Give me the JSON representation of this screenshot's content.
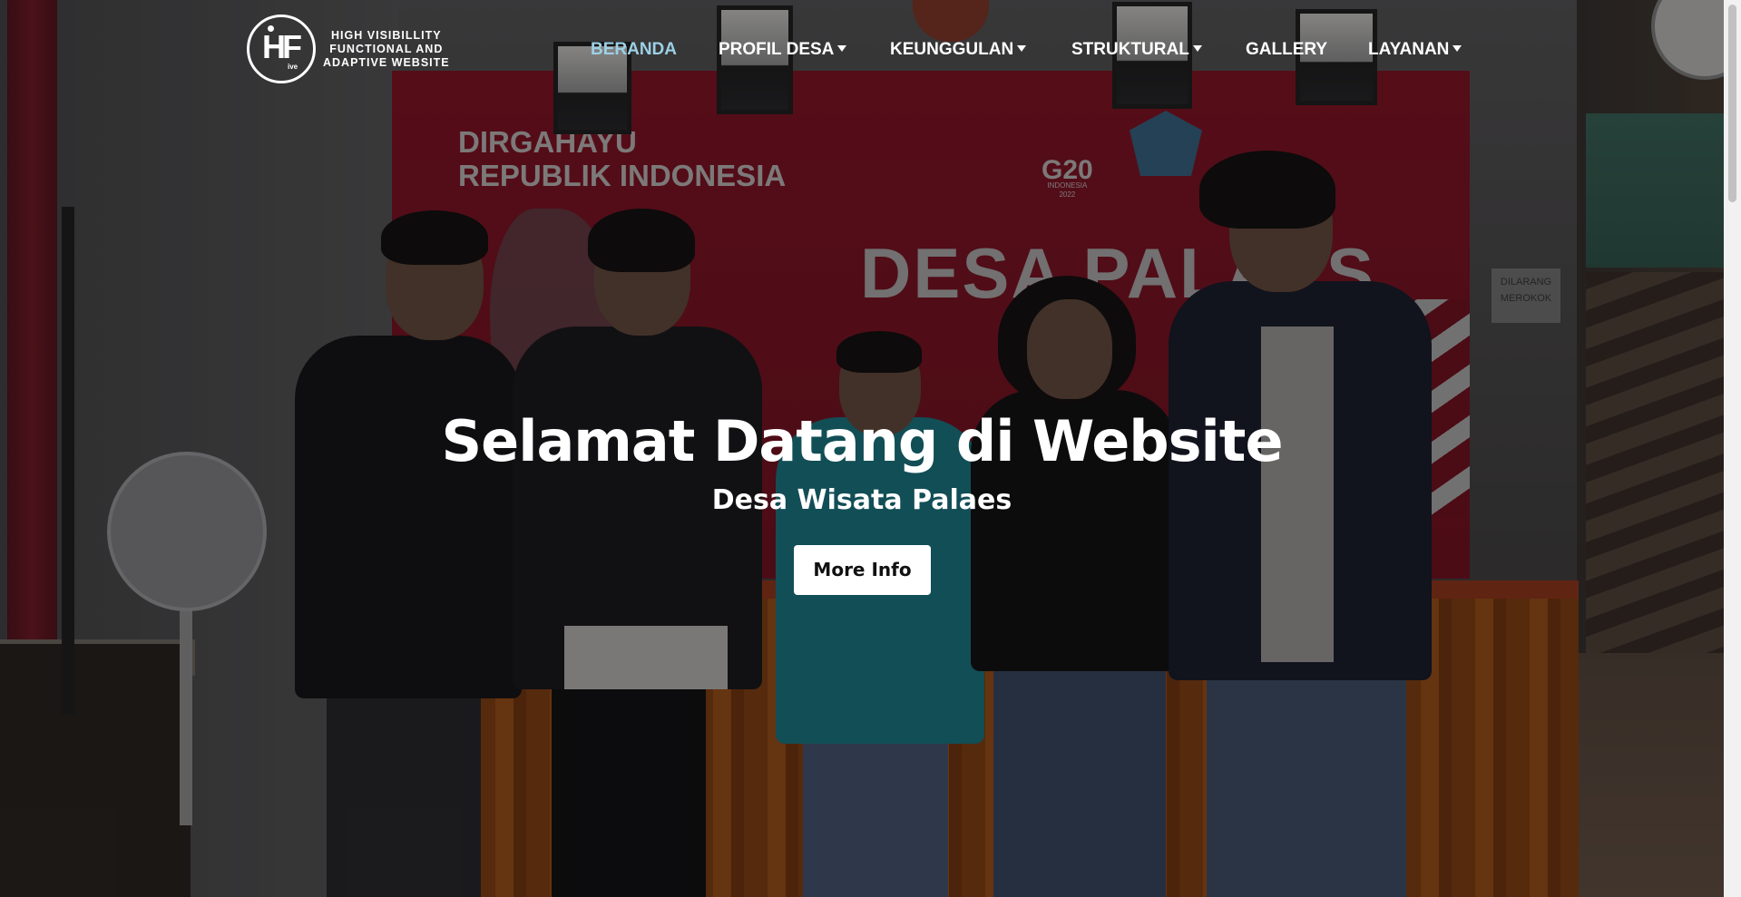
{
  "logo": {
    "mark": "HF",
    "mark_sub": "ive",
    "lines": [
      "HIGH VISIBILLITY",
      "FUNCTIONAL AND",
      "ADAPTIVE WEBSITE"
    ]
  },
  "nav": {
    "items": [
      {
        "label": "BERANDA",
        "dropdown": false,
        "active": true
      },
      {
        "label": "PROFIL DESA",
        "dropdown": true,
        "active": false
      },
      {
        "label": "KEUNGGULAN",
        "dropdown": true,
        "active": false
      },
      {
        "label": "STRUKTURAL",
        "dropdown": true,
        "active": false
      },
      {
        "label": "GALLERY",
        "dropdown": false,
        "active": false
      },
      {
        "label": "LAYANAN",
        "dropdown": true,
        "active": false
      }
    ],
    "active_color": "#9cd0e6"
  },
  "hero": {
    "title": "Selamat Datang di Website",
    "subtitle": "Desa Wisata Palaes",
    "button_label": "More Info",
    "photo_texts": {
      "banner_line1": "DIRGAHAYU",
      "banner_line2": "REPUBLIK INDONESIA",
      "banner_name": "DESA PALAES",
      "g20": "G20",
      "g20_sub1": "INDONESIA",
      "g20_sub2": "2022",
      "sign": "DILARANG MEROKOK"
    }
  }
}
